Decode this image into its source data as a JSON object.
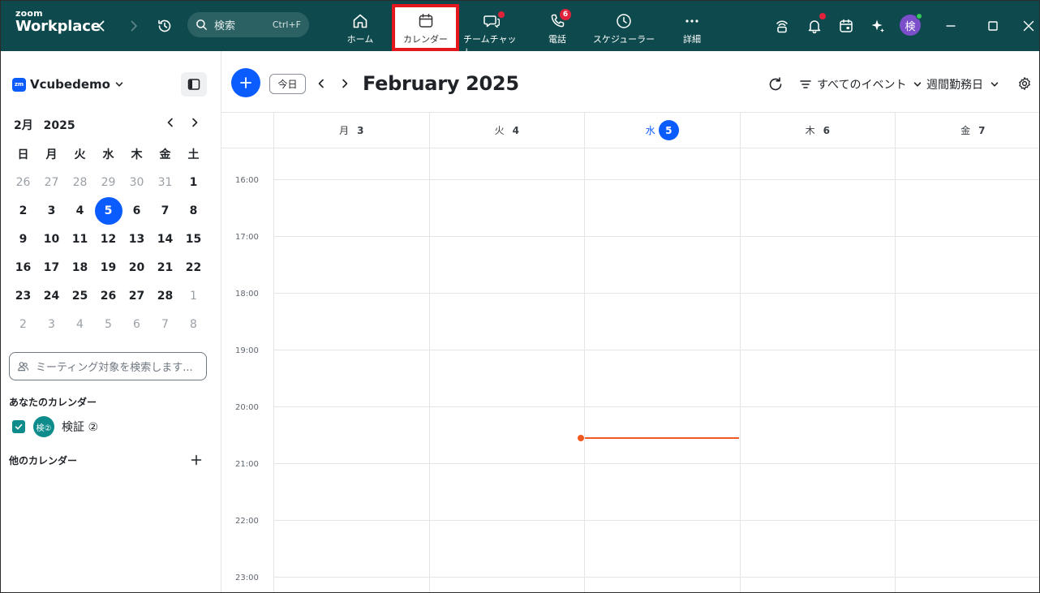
{
  "brand": {
    "small": "zoom",
    "big": "Workplace"
  },
  "search": {
    "placeholder": "検索",
    "shortcut": "Ctrl+F"
  },
  "nav": {
    "tabs": [
      {
        "label": "ホーム",
        "icon": "home-icon"
      },
      {
        "label": "カレンダー",
        "icon": "calendar-icon",
        "active": true
      },
      {
        "label": "チームチャット",
        "icon": "chat-icon",
        "dot": true
      },
      {
        "label": "電話",
        "icon": "phone-icon",
        "badge": "6"
      },
      {
        "label": "スケジューラー",
        "icon": "clock-icon"
      },
      {
        "label": "詳細",
        "icon": "more-icon"
      }
    ]
  },
  "user": {
    "avatar_initial": "検"
  },
  "sidebar": {
    "account": "Vcubedemo",
    "account_logo": "zm",
    "mini_calendar": {
      "header_month": "2月",
      "header_year": "2025",
      "weekdays": [
        "日",
        "月",
        "火",
        "水",
        "木",
        "金",
        "土"
      ],
      "weeks": [
        [
          "26",
          "27",
          "28",
          "29",
          "30",
          "31",
          "1"
        ],
        [
          "2",
          "3",
          "4",
          "5",
          "6",
          "7",
          "8"
        ],
        [
          "9",
          "10",
          "11",
          "12",
          "13",
          "14",
          "15"
        ],
        [
          "16",
          "17",
          "18",
          "19",
          "20",
          "21",
          "22"
        ],
        [
          "23",
          "24",
          "25",
          "26",
          "27",
          "28",
          "1"
        ],
        [
          "2",
          "3",
          "4",
          "5",
          "6",
          "7",
          "8"
        ]
      ],
      "today": "5"
    },
    "people_search_placeholder": "ミーティング対象を検索します...",
    "my_calendars_title": "あなたのカレンダー",
    "my_calendar": {
      "avatar": "検②",
      "name": "検証 ②"
    },
    "other_calendars_title": "他のカレンダー"
  },
  "toolbar": {
    "today_label": "今日",
    "title": "February 2025",
    "filter_label": "すべてのイベント",
    "view_label": "週間勤務日"
  },
  "week": {
    "days": [
      {
        "dow": "月",
        "num": "3"
      },
      {
        "dow": "火",
        "num": "4"
      },
      {
        "dow": "水",
        "num": "5",
        "today": true
      },
      {
        "dow": "木",
        "num": "6"
      },
      {
        "dow": "金",
        "num": "7"
      }
    ],
    "hours": [
      "16:00",
      "17:00",
      "18:00",
      "19:00",
      "20:00",
      "21:00",
      "22:00",
      "23:00"
    ]
  },
  "colors": {
    "topbar": "#0e4a4d",
    "accent": "#0b5cff",
    "now_indicator": "#f05a22",
    "highlight_box": "#e4181c",
    "calendar_color": "#0e8c8c"
  }
}
